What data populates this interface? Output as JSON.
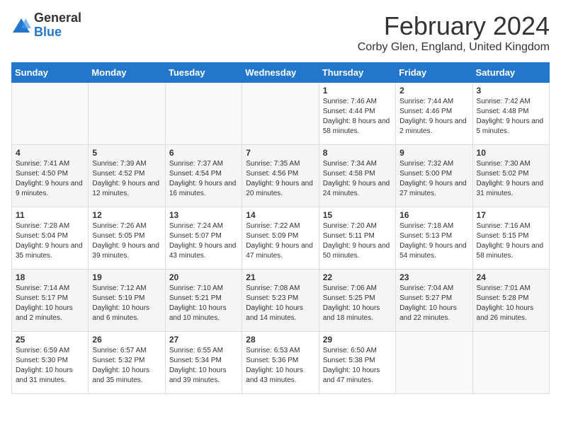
{
  "header": {
    "logo_general": "General",
    "logo_blue": "Blue",
    "title": "February 2024",
    "subtitle": "Corby Glen, England, United Kingdom"
  },
  "days_of_week": [
    "Sunday",
    "Monday",
    "Tuesday",
    "Wednesday",
    "Thursday",
    "Friday",
    "Saturday"
  ],
  "weeks": [
    [
      {
        "day": "",
        "info": ""
      },
      {
        "day": "",
        "info": ""
      },
      {
        "day": "",
        "info": ""
      },
      {
        "day": "",
        "info": ""
      },
      {
        "day": "1",
        "info": "Sunrise: 7:46 AM\nSunset: 4:44 PM\nDaylight: 8 hours and 58 minutes."
      },
      {
        "day": "2",
        "info": "Sunrise: 7:44 AM\nSunset: 4:46 PM\nDaylight: 9 hours and 2 minutes."
      },
      {
        "day": "3",
        "info": "Sunrise: 7:42 AM\nSunset: 4:48 PM\nDaylight: 9 hours and 5 minutes."
      }
    ],
    [
      {
        "day": "4",
        "info": "Sunrise: 7:41 AM\nSunset: 4:50 PM\nDaylight: 9 hours and 9 minutes."
      },
      {
        "day": "5",
        "info": "Sunrise: 7:39 AM\nSunset: 4:52 PM\nDaylight: 9 hours and 12 minutes."
      },
      {
        "day": "6",
        "info": "Sunrise: 7:37 AM\nSunset: 4:54 PM\nDaylight: 9 hours and 16 minutes."
      },
      {
        "day": "7",
        "info": "Sunrise: 7:35 AM\nSunset: 4:56 PM\nDaylight: 9 hours and 20 minutes."
      },
      {
        "day": "8",
        "info": "Sunrise: 7:34 AM\nSunset: 4:58 PM\nDaylight: 9 hours and 24 minutes."
      },
      {
        "day": "9",
        "info": "Sunrise: 7:32 AM\nSunset: 5:00 PM\nDaylight: 9 hours and 27 minutes."
      },
      {
        "day": "10",
        "info": "Sunrise: 7:30 AM\nSunset: 5:02 PM\nDaylight: 9 hours and 31 minutes."
      }
    ],
    [
      {
        "day": "11",
        "info": "Sunrise: 7:28 AM\nSunset: 5:04 PM\nDaylight: 9 hours and 35 minutes."
      },
      {
        "day": "12",
        "info": "Sunrise: 7:26 AM\nSunset: 5:05 PM\nDaylight: 9 hours and 39 minutes."
      },
      {
        "day": "13",
        "info": "Sunrise: 7:24 AM\nSunset: 5:07 PM\nDaylight: 9 hours and 43 minutes."
      },
      {
        "day": "14",
        "info": "Sunrise: 7:22 AM\nSunset: 5:09 PM\nDaylight: 9 hours and 47 minutes."
      },
      {
        "day": "15",
        "info": "Sunrise: 7:20 AM\nSunset: 5:11 PM\nDaylight: 9 hours and 50 minutes."
      },
      {
        "day": "16",
        "info": "Sunrise: 7:18 AM\nSunset: 5:13 PM\nDaylight: 9 hours and 54 minutes."
      },
      {
        "day": "17",
        "info": "Sunrise: 7:16 AM\nSunset: 5:15 PM\nDaylight: 9 hours and 58 minutes."
      }
    ],
    [
      {
        "day": "18",
        "info": "Sunrise: 7:14 AM\nSunset: 5:17 PM\nDaylight: 10 hours and 2 minutes."
      },
      {
        "day": "19",
        "info": "Sunrise: 7:12 AM\nSunset: 5:19 PM\nDaylight: 10 hours and 6 minutes."
      },
      {
        "day": "20",
        "info": "Sunrise: 7:10 AM\nSunset: 5:21 PM\nDaylight: 10 hours and 10 minutes."
      },
      {
        "day": "21",
        "info": "Sunrise: 7:08 AM\nSunset: 5:23 PM\nDaylight: 10 hours and 14 minutes."
      },
      {
        "day": "22",
        "info": "Sunrise: 7:06 AM\nSunset: 5:25 PM\nDaylight: 10 hours and 18 minutes."
      },
      {
        "day": "23",
        "info": "Sunrise: 7:04 AM\nSunset: 5:27 PM\nDaylight: 10 hours and 22 minutes."
      },
      {
        "day": "24",
        "info": "Sunrise: 7:01 AM\nSunset: 5:28 PM\nDaylight: 10 hours and 26 minutes."
      }
    ],
    [
      {
        "day": "25",
        "info": "Sunrise: 6:59 AM\nSunset: 5:30 PM\nDaylight: 10 hours and 31 minutes."
      },
      {
        "day": "26",
        "info": "Sunrise: 6:57 AM\nSunset: 5:32 PM\nDaylight: 10 hours and 35 minutes."
      },
      {
        "day": "27",
        "info": "Sunrise: 6:55 AM\nSunset: 5:34 PM\nDaylight: 10 hours and 39 minutes."
      },
      {
        "day": "28",
        "info": "Sunrise: 6:53 AM\nSunset: 5:36 PM\nDaylight: 10 hours and 43 minutes."
      },
      {
        "day": "29",
        "info": "Sunrise: 6:50 AM\nSunset: 5:38 PM\nDaylight: 10 hours and 47 minutes."
      },
      {
        "day": "",
        "info": ""
      },
      {
        "day": "",
        "info": ""
      }
    ]
  ]
}
